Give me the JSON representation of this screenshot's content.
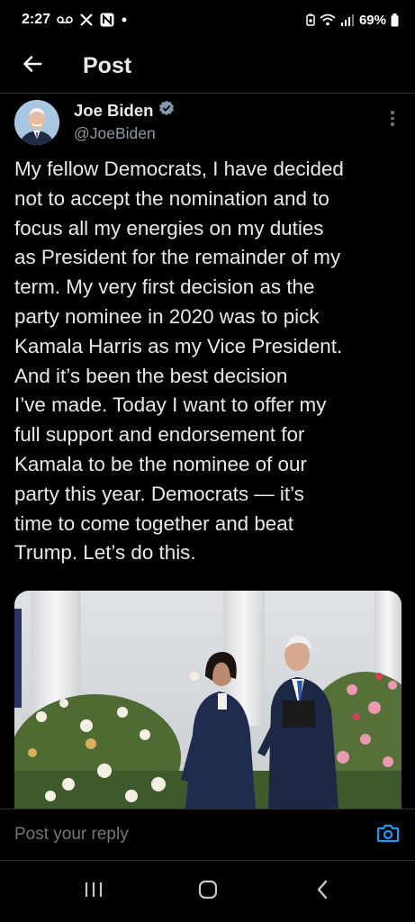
{
  "status_bar": {
    "time": "2:27",
    "battery": "69%",
    "icons": [
      "voicemail-icon",
      "x-app-icon",
      "n-app-icon",
      "notification-dot-icon",
      "battery-saver-icon",
      "wifi-icon",
      "signal-icon",
      "battery-icon"
    ]
  },
  "header": {
    "title": "Post",
    "back_icon": "back-arrow-icon"
  },
  "post": {
    "author_name": "Joe Biden",
    "author_handle": "@JoeBiden",
    "verified_icon": "verified-badge-icon",
    "more_icon": "more-options-icon",
    "text": "My fellow Democrats, I have decided\nnot to accept the nomination and to\nfocus all my energies on my duties\nas President for the remainder of my\nterm. My very first decision as the\nparty nominee in 2020 was to pick\nKamala Harris as my Vice President.\nAnd it’s been the best decision\nI’ve made. Today I want to offer my\nfull support and endorsement for\nKamala to be the nominee of our\nparty this year. Democrats — it’s\ntime to come together and beat\nTrump. Let’s do this.",
    "image": "photo-two-people-garden"
  },
  "reply": {
    "placeholder": "Post your reply",
    "camera_icon": "camera-icon"
  },
  "nav": {
    "icons": [
      "recents-icon",
      "home-icon",
      "back-icon"
    ]
  },
  "colors": {
    "background": "#000000",
    "text": "#e7e9ea",
    "secondary": "#71767b",
    "accent": "#1d9bf0",
    "border": "#2f3336"
  }
}
